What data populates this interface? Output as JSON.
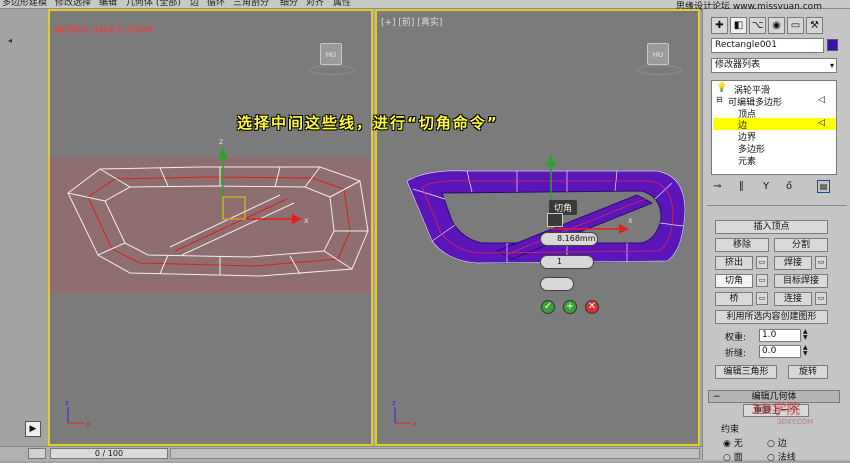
{
  "menu": {
    "items": [
      "多边形建模",
      "修改选择",
      "编辑",
      "几何体 (全部)",
      "边",
      "循环",
      "三角剖分",
      "细分",
      "对齐",
      "属性"
    ]
  },
  "site_credit": "思缘设计论坛 www.missyuan.com",
  "viewport_left": {
    "watermark": "WWW.3DXY.COM",
    "nav_label": "HU",
    "axis_labels": [
      "z",
      "x"
    ]
  },
  "viewport_right": {
    "label": "[+] [前] [真实]",
    "nav_label": "HU",
    "axis_labels": [
      "z",
      "x"
    ]
  },
  "caption": "选择中间这些线，进行“切角命令”",
  "caddy": {
    "title": "切角",
    "amount": "8.168mm",
    "segments": "1",
    "ok_icon": "check-icon",
    "apply_icon": "plus-icon",
    "cancel_icon": "x-icon"
  },
  "timeline": {
    "frame": "0 / 100"
  },
  "panel": {
    "object_name": "Rectangle001",
    "object_color": "#3a12a8",
    "modifier_list": "修改器列表",
    "stack": [
      {
        "label": "涡轮平滑",
        "indent": 0
      },
      {
        "label": "可编辑多边形",
        "indent": 0
      },
      {
        "label": "顶点",
        "indent": 1
      },
      {
        "label": "边",
        "indent": 1,
        "selected": true
      },
      {
        "label": "边界",
        "indent": 1
      },
      {
        "label": "多边形",
        "indent": 1
      },
      {
        "label": "元素",
        "indent": 1
      }
    ],
    "buttons": {
      "insert_vertex": "插入顶点",
      "remove": "移除",
      "split": "分割",
      "extrude": "挤出",
      "weld": "焊接",
      "chamfer": "切角",
      "target_weld": "目标焊接",
      "bridge": "桥",
      "connect": "连接",
      "create_shape": "利用所选内容创建图形",
      "edit_tri": "编辑三角形",
      "turn": "旋转",
      "repeat_last": "重复上一个"
    },
    "weight_label": "权重:",
    "weight_value": "1.0",
    "crease_label": "折缝:",
    "crease_value": "0.0",
    "rollout_title": "编辑几何体",
    "constraints_label": "约束",
    "constraint_options": [
      "无",
      "边",
      "面",
      "法线"
    ],
    "logo_text": "3D学院",
    "logo_sub": "3DXY.COM"
  },
  "colors": {
    "viewport_border": "#e3cc2a",
    "selected_mesh": "#6a1ac0",
    "stack_highlight": "#ffff00"
  }
}
